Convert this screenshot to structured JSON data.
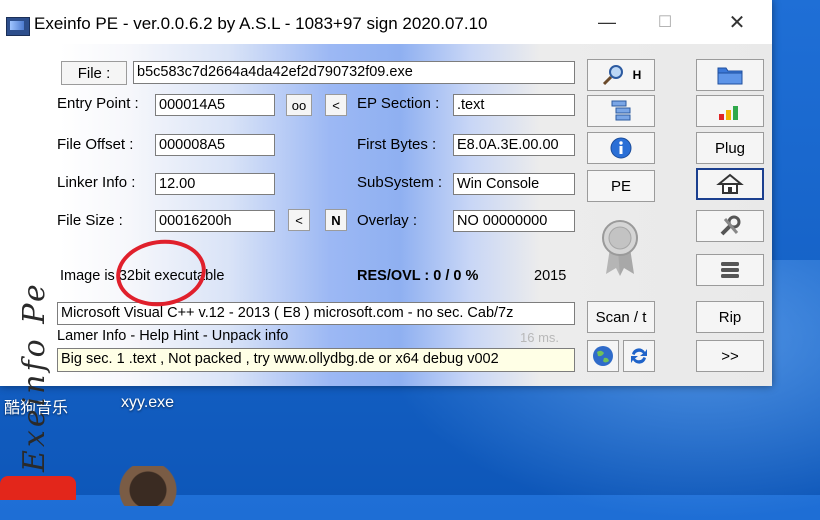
{
  "window": {
    "title": "Exeinfo PE - ver.0.0.6.2  by A.S.L -  1083+97 sign  2020.07.10",
    "controls": {
      "minimize": "—",
      "maximize": "☐",
      "close": "✕"
    }
  },
  "brand": {
    "logo_text": "Exeinfo Pe"
  },
  "fields": {
    "file_label": "File :",
    "file_value": "b5c583c7d2664a4da42ef2d790732f09.exe",
    "entry_point_label": "Entry Point :",
    "entry_point_value": "000014A5",
    "oo_label": "oo",
    "lt_label": "<",
    "file_offset_label": "File Offset :",
    "file_offset_value": "000008A5",
    "linker_info_label": "Linker Info :",
    "linker_info_value": "12.00",
    "file_size_label": "File Size :",
    "file_size_value": "00016200h",
    "size_lt_label": "<",
    "n_label": "N",
    "ep_section_label": "EP Section :",
    "ep_section_value": ".text",
    "first_bytes_label": "First Bytes :",
    "first_bytes_value": "E8.0A.3E.00.00",
    "subsystem_label": "SubSystem :",
    "subsystem_value": "Win Console",
    "overlay_label": "Overlay :",
    "overlay_value": "NO  00000000"
  },
  "info": {
    "image_type": "Image is 32bit executable",
    "res_ovl": "RES/OVL : 0 / 0 %",
    "year": "2015",
    "detection": "Microsoft Visual C++ v.12 - 2013 ( E8 ) microsoft.com - no sec. Cab/7z",
    "lamer_info": "Lamer Info - Help Hint - Unpack info",
    "timing": "16 ms.",
    "hint": "Big sec. 1 .text , Not packed , try  www.ollydbg.de or x64 debug v002"
  },
  "buttons": {
    "search_h": "H",
    "pe": "PE",
    "scan": "Scan / t",
    "plug": "Plug",
    "rip": "Rip",
    "next": ">>"
  },
  "desktop": {
    "icon1_label": "酷狗音乐",
    "icon2_label": "xyy.exe"
  },
  "colors": {
    "accent": "#1b3f8f",
    "annotation": "#e0202c",
    "desktop": "#1663c8"
  }
}
